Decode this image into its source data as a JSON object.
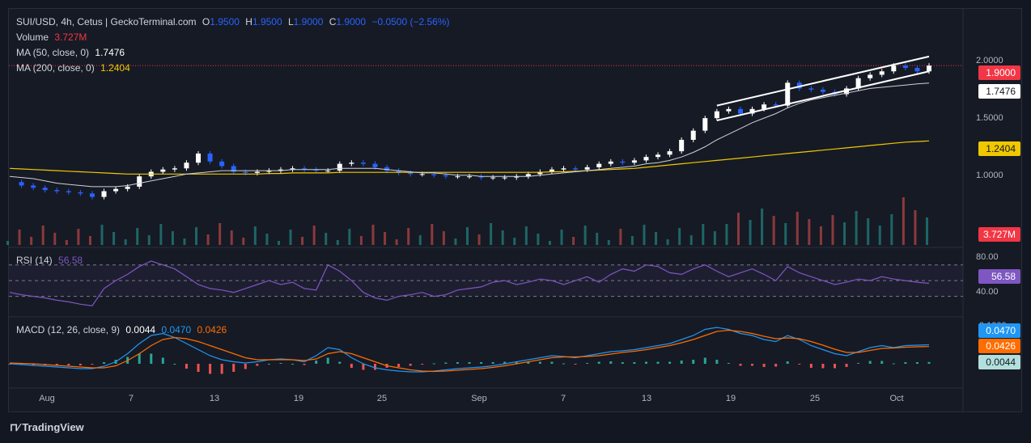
{
  "header": {
    "symbol": "SUI/USD, 4h, Cetus | GeckoTerminal.com",
    "o_label": "O",
    "o": "1.9500",
    "h_label": "H",
    "h": "1.9500",
    "l_label": "L",
    "l": "1.9000",
    "c_label": "C",
    "c": "1.9000",
    "change": "−0.0500 (−2.56%)",
    "volume_label": "Volume",
    "volume": "3.727M",
    "ma50_label": "MA (50, close, 0)",
    "ma50": "1.7476",
    "ma200_label": "MA (200, close, 0)",
    "ma200": "1.2404"
  },
  "price_axis": {
    "ticks": [
      "2.0000",
      "1.5000",
      "1.0000"
    ]
  },
  "price_labels": {
    "last": "1.9000",
    "ma50": "1.7476",
    "ma200": "1.2404",
    "volume": "3.727M"
  },
  "rsi": {
    "label": "RSI (14)",
    "value": "56.58",
    "ticks": [
      "80.00",
      "40.00"
    ]
  },
  "macd": {
    "label": "MACD (12, 26, close, 9)",
    "hist": "0.0044",
    "macd": "0.0470",
    "signal": "0.0426",
    "top_tick": "0.1000"
  },
  "x_axis": [
    "Aug",
    "7",
    "13",
    "19",
    "25",
    "Sep",
    "7",
    "13",
    "19",
    "25",
    "Oct"
  ],
  "brand": "TradingView",
  "colors": {
    "up": "#ffffff",
    "down": "#2962ff",
    "ma50": "#cfd1d8",
    "ma200": "#f0c800",
    "rsi": "#7e57c2",
    "macd": "#2196f3",
    "signal": "#ff6d00",
    "last": "#f23645"
  },
  "chart_data": {
    "type": "line",
    "title": "SUI/USD, 4h, Cetus | GeckoTerminal.com",
    "x_labels": [
      "Aug",
      "7",
      "13",
      "19",
      "25",
      "Sep",
      "7",
      "13",
      "19",
      "25",
      "Oct"
    ],
    "price_range": [
      0.74,
      2.05
    ],
    "price_series": [
      {
        "name": "SUI/USD",
        "values": [
          0.88,
          0.85,
          0.83,
          0.81,
          0.8,
          0.79,
          0.78,
          0.75,
          0.8,
          0.82,
          0.84,
          0.93,
          0.97,
          0.99,
          1.0,
          1.05,
          1.13,
          1.06,
          1.02,
          0.97,
          0.96,
          0.97,
          0.98,
          0.99,
          1.0,
          0.99,
          0.98,
          0.98,
          1.04,
          1.05,
          1.04,
          1.01,
          0.98,
          0.96,
          0.95,
          0.95,
          0.94,
          0.93,
          0.93,
          0.93,
          0.92,
          0.92,
          0.92,
          0.93,
          0.95,
          0.97,
          0.99,
          1.0,
          0.99,
          1.01,
          1.04,
          1.06,
          1.05,
          1.07,
          1.1,
          1.12,
          1.15,
          1.25,
          1.33,
          1.44,
          1.5,
          1.52,
          1.48,
          1.52,
          1.56,
          1.55,
          1.75,
          1.7,
          1.69,
          1.67,
          1.65,
          1.7,
          1.79,
          1.82,
          1.85,
          1.9,
          1.88,
          1.85,
          1.9
        ]
      },
      {
        "name": "MA (50, close, 0)",
        "values": [
          0.93,
          0.92,
          0.91,
          0.89,
          0.87,
          0.86,
          0.85,
          0.84,
          0.84,
          0.84,
          0.85,
          0.87,
          0.89,
          0.91,
          0.93,
          0.95,
          0.96,
          0.97,
          0.98,
          0.98,
          0.98,
          0.98,
          0.98,
          0.98,
          0.99,
          0.99,
          0.99,
          0.99,
          1.0,
          1.0,
          1.0,
          1.0,
          0.99,
          0.98,
          0.97,
          0.96,
          0.96,
          0.95,
          0.94,
          0.94,
          0.93,
          0.93,
          0.93,
          0.93,
          0.93,
          0.94,
          0.95,
          0.96,
          0.97,
          0.98,
          0.99,
          1.0,
          1.01,
          1.02,
          1.04,
          1.05,
          1.07,
          1.1,
          1.14,
          1.19,
          1.25,
          1.3,
          1.35,
          1.4,
          1.44,
          1.48,
          1.53,
          1.57,
          1.6,
          1.62,
          1.64,
          1.66,
          1.68,
          1.7,
          1.71,
          1.72,
          1.73,
          1.74,
          1.7476
        ]
      },
      {
        "name": "MA (200, close, 0)",
        "values": [
          1.0,
          0.995,
          0.99,
          0.985,
          0.98,
          0.975,
          0.97,
          0.965,
          0.96,
          0.955,
          0.95,
          0.95,
          0.95,
          0.95,
          0.95,
          0.95,
          0.95,
          0.95,
          0.95,
          0.95,
          0.95,
          0.95,
          0.955,
          0.955,
          0.96,
          0.96,
          0.96,
          0.96,
          0.965,
          0.965,
          0.965,
          0.965,
          0.965,
          0.965,
          0.965,
          0.965,
          0.965,
          0.965,
          0.965,
          0.965,
          0.965,
          0.965,
          0.965,
          0.965,
          0.965,
          0.965,
          0.97,
          0.97,
          0.975,
          0.98,
          0.985,
          0.99,
          0.995,
          1.0,
          1.01,
          1.02,
          1.03,
          1.04,
          1.05,
          1.06,
          1.07,
          1.08,
          1.09,
          1.1,
          1.11,
          1.12,
          1.13,
          1.14,
          1.15,
          1.16,
          1.17,
          1.18,
          1.19,
          1.2,
          1.21,
          1.22,
          1.23,
          1.235,
          1.2404
        ]
      }
    ],
    "rsi": {
      "name": "RSI (14)",
      "range": [
        20,
        90
      ],
      "values": [
        45,
        42,
        40,
        38,
        35,
        33,
        30,
        28,
        50,
        60,
        68,
        78,
        85,
        80,
        75,
        65,
        55,
        50,
        48,
        45,
        50,
        55,
        60,
        55,
        58,
        50,
        48,
        80,
        72,
        60,
        45,
        38,
        35,
        40,
        42,
        45,
        40,
        42,
        48,
        50,
        52,
        58,
        60,
        55,
        58,
        62,
        60,
        55,
        60,
        65,
        58,
        68,
        75,
        72,
        80,
        78,
        70,
        68,
        75,
        80,
        72,
        65,
        70,
        75,
        68,
        60,
        78,
        70,
        65,
        60,
        55,
        58,
        62,
        60,
        65,
        62,
        60,
        58,
        56.58
      ]
    },
    "macd": {
      "name": "MACD (12, 26, close, 9)",
      "range": [
        -0.04,
        0.1
      ],
      "macd_values": [
        0.0,
        -0.002,
        -0.004,
        -0.006,
        -0.008,
        -0.01,
        -0.012,
        -0.012,
        -0.006,
        0.005,
        0.025,
        0.05,
        0.07,
        0.075,
        0.065,
        0.05,
        0.035,
        0.02,
        0.01,
        0.005,
        0.002,
        0.005,
        0.01,
        0.012,
        0.01,
        0.005,
        0.02,
        0.04,
        0.035,
        0.015,
        0.0,
        -0.01,
        -0.015,
        -0.018,
        -0.02,
        -0.02,
        -0.018,
        -0.015,
        -0.012,
        -0.01,
        -0.008,
        -0.005,
        0.0,
        0.005,
        0.01,
        0.015,
        0.02,
        0.018,
        0.015,
        0.02,
        0.025,
        0.03,
        0.032,
        0.035,
        0.04,
        0.045,
        0.05,
        0.06,
        0.07,
        0.085,
        0.09,
        0.085,
        0.075,
        0.07,
        0.06,
        0.055,
        0.07,
        0.06,
        0.045,
        0.035,
        0.025,
        0.02,
        0.03,
        0.04,
        0.045,
        0.04,
        0.045,
        0.046,
        0.047
      ],
      "signal_values": [
        0.002,
        0.001,
        0.0,
        -0.002,
        -0.004,
        -0.006,
        -0.008,
        -0.01,
        -0.01,
        -0.005,
        0.008,
        0.025,
        0.045,
        0.06,
        0.065,
        0.062,
        0.055,
        0.045,
        0.035,
        0.025,
        0.015,
        0.01,
        0.01,
        0.01,
        0.01,
        0.008,
        0.012,
        0.025,
        0.03,
        0.025,
        0.015,
        0.005,
        -0.005,
        -0.01,
        -0.015,
        -0.018,
        -0.019,
        -0.018,
        -0.016,
        -0.014,
        -0.012,
        -0.009,
        -0.005,
        0.0,
        0.005,
        0.01,
        0.015,
        0.017,
        0.017,
        0.018,
        0.02,
        0.024,
        0.028,
        0.031,
        0.035,
        0.04,
        0.045,
        0.052,
        0.06,
        0.07,
        0.08,
        0.083,
        0.08,
        0.075,
        0.068,
        0.062,
        0.064,
        0.062,
        0.055,
        0.046,
        0.036,
        0.028,
        0.028,
        0.033,
        0.038,
        0.039,
        0.041,
        0.042,
        0.0426
      ]
    }
  }
}
